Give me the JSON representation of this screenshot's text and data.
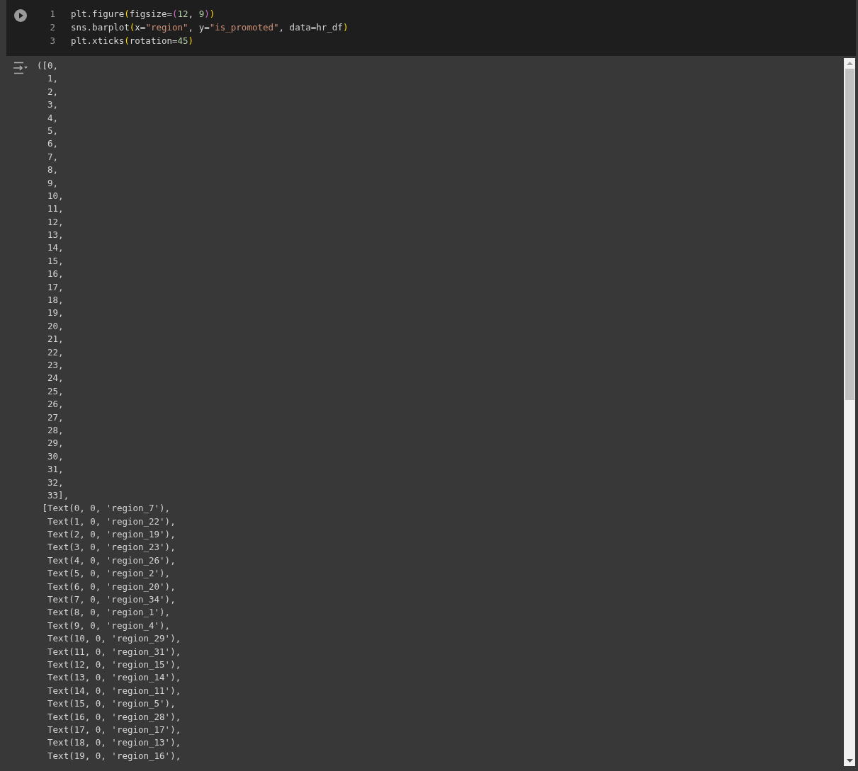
{
  "cell": {
    "code_lines": [
      {
        "number": "1",
        "tokens": [
          {
            "kind": "plain",
            "text": "plt.figure"
          },
          {
            "kind": "paren",
            "text": "("
          },
          {
            "kind": "plain",
            "text": "figsize="
          },
          {
            "kind": "paren2",
            "text": "("
          },
          {
            "kind": "number",
            "text": "12"
          },
          {
            "kind": "plain",
            "text": ", "
          },
          {
            "kind": "number",
            "text": "9"
          },
          {
            "kind": "paren2",
            "text": ")"
          },
          {
            "kind": "paren",
            "text": ")"
          }
        ]
      },
      {
        "number": "2",
        "tokens": [
          {
            "kind": "plain",
            "text": "sns.barplot"
          },
          {
            "kind": "paren",
            "text": "("
          },
          {
            "kind": "plain",
            "text": "x="
          },
          {
            "kind": "string",
            "text": "\"region\""
          },
          {
            "kind": "plain",
            "text": ", y="
          },
          {
            "kind": "string",
            "text": "\"is_promoted\""
          },
          {
            "kind": "plain",
            "text": ", data=hr_df"
          },
          {
            "kind": "paren",
            "text": ")"
          }
        ]
      },
      {
        "number": "3",
        "tokens": [
          {
            "kind": "plain",
            "text": "plt.xticks"
          },
          {
            "kind": "paren",
            "text": "("
          },
          {
            "kind": "plain",
            "text": "rotation="
          },
          {
            "kind": "number",
            "text": "45"
          },
          {
            "kind": "paren",
            "text": ")"
          }
        ]
      }
    ],
    "output_lines": [
      "([0,",
      "  1,",
      "  2,",
      "  3,",
      "  4,",
      "  5,",
      "  6,",
      "  7,",
      "  8,",
      "  9,",
      "  10,",
      "  11,",
      "  12,",
      "  13,",
      "  14,",
      "  15,",
      "  16,",
      "  17,",
      "  18,",
      "  19,",
      "  20,",
      "  21,",
      "  22,",
      "  23,",
      "  24,",
      "  25,",
      "  26,",
      "  27,",
      "  28,",
      "  29,",
      "  30,",
      "  31,",
      "  32,",
      "  33],",
      " [Text(0, 0, 'region_7'),",
      "  Text(1, 0, 'region_22'),",
      "  Text(2, 0, 'region_19'),",
      "  Text(3, 0, 'region_23'),",
      "  Text(4, 0, 'region_26'),",
      "  Text(5, 0, 'region_2'),",
      "  Text(6, 0, 'region_20'),",
      "  Text(7, 0, 'region_34'),",
      "  Text(8, 0, 'region_1'),",
      "  Text(9, 0, 'region_4'),",
      "  Text(10, 0, 'region_29'),",
      "  Text(11, 0, 'region_31'),",
      "  Text(12, 0, 'region_15'),",
      "  Text(13, 0, 'region_14'),",
      "  Text(14, 0, 'region_11'),",
      "  Text(15, 0, 'region_5'),",
      "  Text(16, 0, 'region_28'),",
      "  Text(17, 0, 'region_17'),",
      "  Text(18, 0, 'region_13'),",
      "  Text(19, 0, 'region_16'),"
    ]
  }
}
